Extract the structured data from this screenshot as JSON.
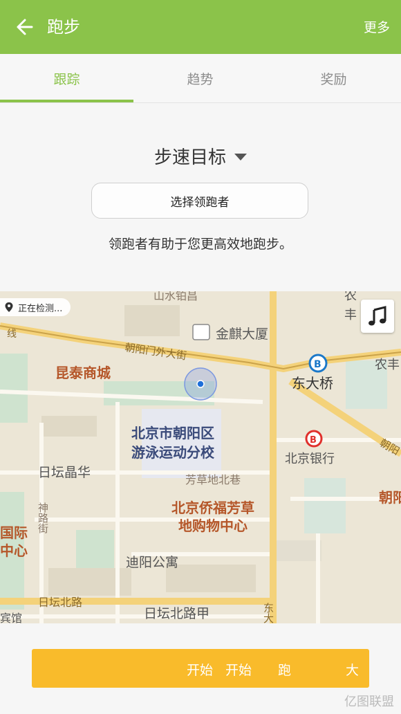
{
  "appbar": {
    "title": "跑步",
    "more": "更多",
    "back_icon": "arrow-left-icon"
  },
  "tabs": [
    {
      "label": "跟踪",
      "active": true
    },
    {
      "label": "趋势",
      "active": false
    },
    {
      "label": "奖励",
      "active": false
    }
  ],
  "goal": {
    "title": "步速目标"
  },
  "pacer": {
    "button_label": "选择领跑者",
    "description": "领跑者有助于您更高效地跑步。"
  },
  "map": {
    "gps_status": "正在检测...",
    "labels": {
      "shanshui": "山水铂昌",
      "jinqi": "金麒大厦",
      "chaoyangmenwai": "朝阳门外大街",
      "kuntai": "昆泰商城",
      "dongdaqiao": "东大桥",
      "nong": "农",
      "nong2": "农丰",
      "feng": "丰",
      "beijing_bank": "北京银行",
      "chaoyang": "朝阳",
      "swim_school_1": "北京市朝阳区",
      "swim_school_2": "游泳运动分校",
      "ritan_jinghua": "日坛晶华",
      "fangcaodi": "芳草地北巷",
      "shennu": "神路街",
      "mall_1": "北京侨福芳草",
      "mall_2": "地购物中心",
      "guoji_1": "国际",
      "guoji_2": "中心",
      "diyang": "迪阳公寓",
      "ritan_north_road": "日坛北路",
      "ritan_north_road_a": "日坛北路甲",
      "binguan": "宾馆",
      "dong": "东大",
      "xian": "线",
      "chao": "朝",
      "chaoyang_road": "朝阳"
    }
  },
  "start_button": {
    "label_1": "开始",
    "label_2": "开始",
    "label_3": "跑",
    "label_4": "大"
  },
  "watermark": "亿图联盟",
  "colors": {
    "brand_green": "#8bc34a",
    "start_yellow": "#f9bb2b"
  }
}
